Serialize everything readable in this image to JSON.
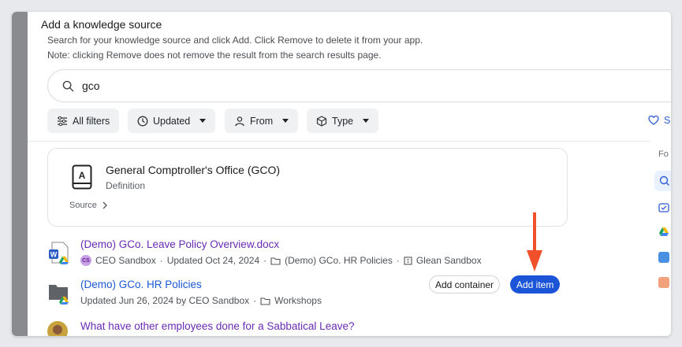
{
  "dialog": {
    "title": "Add a knowledge source",
    "description_line1": "Search for your knowledge source and click Add. Click Remove to delete it from your app.",
    "description_line2": "Note: clicking Remove does not remove the result from the search results page."
  },
  "search": {
    "value": "gco"
  },
  "filters": [
    {
      "label": "All filters",
      "icon": "filter-icon"
    },
    {
      "label": "Updated",
      "icon": "clock-icon"
    },
    {
      "label": "From",
      "icon": "person-icon"
    },
    {
      "label": "Type",
      "icon": "cube-icon"
    }
  ],
  "save_label": "S",
  "definition_card": {
    "title": "General Comptroller's Office (GCO)",
    "subtitle": "Definition",
    "source_label": "Source",
    "icon_letter": "A"
  },
  "right_panel": {
    "label": "Fo"
  },
  "results": [
    {
      "title": "(Demo) GCo. Leave Policy Overview.docx",
      "badge": "CS",
      "owner": "CEO Sandbox",
      "updated": "Updated Oct 24, 2024",
      "folder": "(Demo) GCo. HR Policies",
      "location": "Glean Sandbox"
    },
    {
      "title": "(Demo) GCo. HR Policies",
      "updated": "Updated Jun 26, 2024 by CEO Sandbox",
      "folder": "Workshops"
    },
    {
      "title": "What have other employees done for a Sabbatical Leave?"
    }
  ],
  "buttons": {
    "add_container": "Add container",
    "add_item": "Add item"
  },
  "colors": {
    "accent": "#1c54d8",
    "link_purple": "#6a2bb5",
    "arrow": "#f0502a"
  }
}
